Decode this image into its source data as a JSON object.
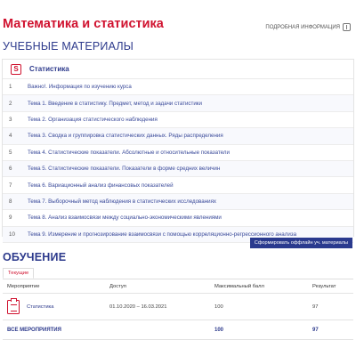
{
  "header": {
    "title": "Математика и статистика",
    "offline_link": "ПОДРОБНАЯ ИНФОРМАЦИЯ",
    "offline_icon": "info-icon"
  },
  "materials": {
    "section_title": "УЧЕБНЫЕ МАТЕРИАЛЫ",
    "panel_title": "Статистика",
    "panel_icon": "subject-icon",
    "icon_letter": "S",
    "items": [
      {
        "num": "1",
        "label": "Важно!. Информация по изучению курса"
      },
      {
        "num": "2",
        "label": "Тема 1. Введение в статистику. Предмет, метод и задачи статистики"
      },
      {
        "num": "3",
        "label": "Тема 2. Организация статистического наблюдения"
      },
      {
        "num": "4",
        "label": "Тема 3. Сводка и группировка статистических данных. Ряды распределения"
      },
      {
        "num": "5",
        "label": "Тема 4. Статистические показатели. Абсолютные и относительные показатели"
      },
      {
        "num": "6",
        "label": "Тема 5. Статистические показатели. Показатели в форме средних величин"
      },
      {
        "num": "7",
        "label": "Тема 6. Вариационный анализ финансовых показателей"
      },
      {
        "num": "8",
        "label": "Тема 7. Выборочный метод наблюдения в статистических исследованиях"
      },
      {
        "num": "9",
        "label": "Тема 8. Анализ взаимосвязи между социально-экономическими явлениями"
      },
      {
        "num": "10",
        "label": "Тема 9. Измерение и прогнозирование взаимосвязи с помощью корреляционно-регрессионного анализа"
      }
    ],
    "offline_button": "Сформировать оффлайн уч. материалы"
  },
  "training": {
    "section_title": "ОБУЧЕНИЕ",
    "tab_current": "Текущие",
    "columns": {
      "event": "Мероприятие",
      "access": "Доступ",
      "max_score": "Максимальный балл",
      "result": "Результат"
    },
    "rows": [
      {
        "event": "Статистика",
        "access": "01.10.2020 – 16.03.2021",
        "max_score": "100",
        "result": "97"
      }
    ],
    "total": {
      "label": "ВСЕ МЕРОПРИЯТИЯ",
      "max_score": "100",
      "result": "97"
    }
  },
  "colors": {
    "accent_red": "#d0122f",
    "brand_blue": "#2d3a8c",
    "button_blue": "#2a3a8e"
  }
}
